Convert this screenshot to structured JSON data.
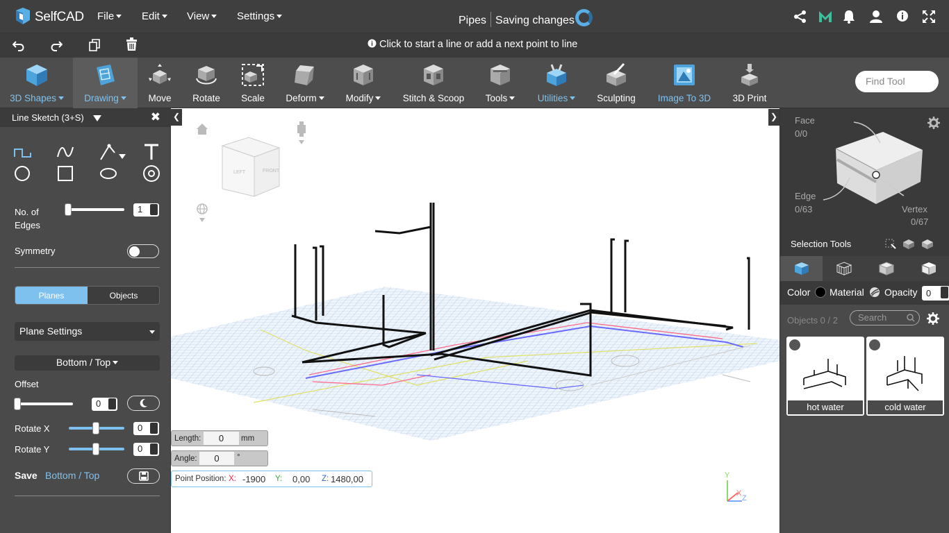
{
  "app": {
    "name": "SelfCAD"
  },
  "menu": [
    {
      "label": "File"
    },
    {
      "label": "Edit"
    },
    {
      "label": "View"
    },
    {
      "label": "Settings"
    }
  ],
  "project": {
    "name": "Pipes",
    "status": "Saving changes"
  },
  "hint": "Click to start a line or add a next point to line",
  "tools": [
    {
      "label": "3D Shapes",
      "icon": "cube-icon",
      "dropdown": true,
      "highlight": true
    },
    {
      "label": "Drawing",
      "icon": "drawing-icon",
      "dropdown": true,
      "highlight": true
    },
    {
      "label": "Move",
      "icon": "move-icon"
    },
    {
      "label": "Rotate",
      "icon": "rotate-icon"
    },
    {
      "label": "Scale",
      "icon": "scale-icon"
    },
    {
      "label": "Deform",
      "icon": "deform-icon",
      "dropdown": true
    },
    {
      "label": "Modify",
      "icon": "modify-icon",
      "dropdown": true
    },
    {
      "label": "Stitch & Scoop",
      "icon": "stitch-scoop-icon"
    },
    {
      "label": "Tools",
      "icon": "tools-icon",
      "dropdown": true
    },
    {
      "label": "Utilities",
      "icon": "utilities-icon",
      "dropdown": true,
      "highlight": true
    },
    {
      "label": "Sculpting",
      "icon": "sculpting-icon"
    },
    {
      "label": "Image To 3D",
      "icon": "image-to-3d-icon",
      "highlight": true
    },
    {
      "label": "3D Print",
      "icon": "3d-print-icon"
    }
  ],
  "find_tool": {
    "placeholder": "Find Tool"
  },
  "left_panel": {
    "title": "Line Sketch (3+S)",
    "edges_label": "No. of Edges",
    "edges_value": "1",
    "symmetry_label": "Symmetry",
    "planes_tab": "Planes",
    "objects_tab": "Objects",
    "plane_settings": "Plane Settings",
    "plane_select": "Bottom / Top",
    "offset_label": "Offset",
    "offset_value": "0",
    "rotate_x_label": "Rotate X",
    "rotate_x_value": "0",
    "rotate_y_label": "Rotate Y",
    "rotate_y_value": "0",
    "save_label": "Save",
    "save_plane": "Bottom / Top"
  },
  "viewport": {
    "length_label": "Length:",
    "length_value": "0",
    "length_unit": "mm",
    "angle_label": "Angle:",
    "angle_value": "0",
    "angle_unit": "°",
    "point_label": "Point Position:",
    "x_label": "X:",
    "x_value": "-1900",
    "y_label": "Y:",
    "y_value": "0,00",
    "z_label": "Z:",
    "z_value": "1480,00",
    "cube_left": "LEFT",
    "cube_front": "FRONT",
    "axis_y": "Y",
    "axis_x": "X",
    "axis_z": "Z"
  },
  "right_panel": {
    "face_label": "Face",
    "face_value": "0/0",
    "edge_label": "Edge",
    "edge_value": "0/63",
    "vertex_label": "Vertex",
    "vertex_value": "0/67",
    "selection_tools": "Selection Tools",
    "color_label": "Color",
    "material_label": "Material",
    "opacity_label": "Opacity",
    "opacity_value": "0",
    "objects_count": "Objects 0 / 2",
    "search_placeholder": "Search",
    "objects": [
      {
        "name": "hot water"
      },
      {
        "name": "cold water"
      }
    ]
  },
  "colors": {
    "accent": "#7fc1ee",
    "toolbar": "#4d4d4d",
    "panel": "#4a4a4a"
  }
}
